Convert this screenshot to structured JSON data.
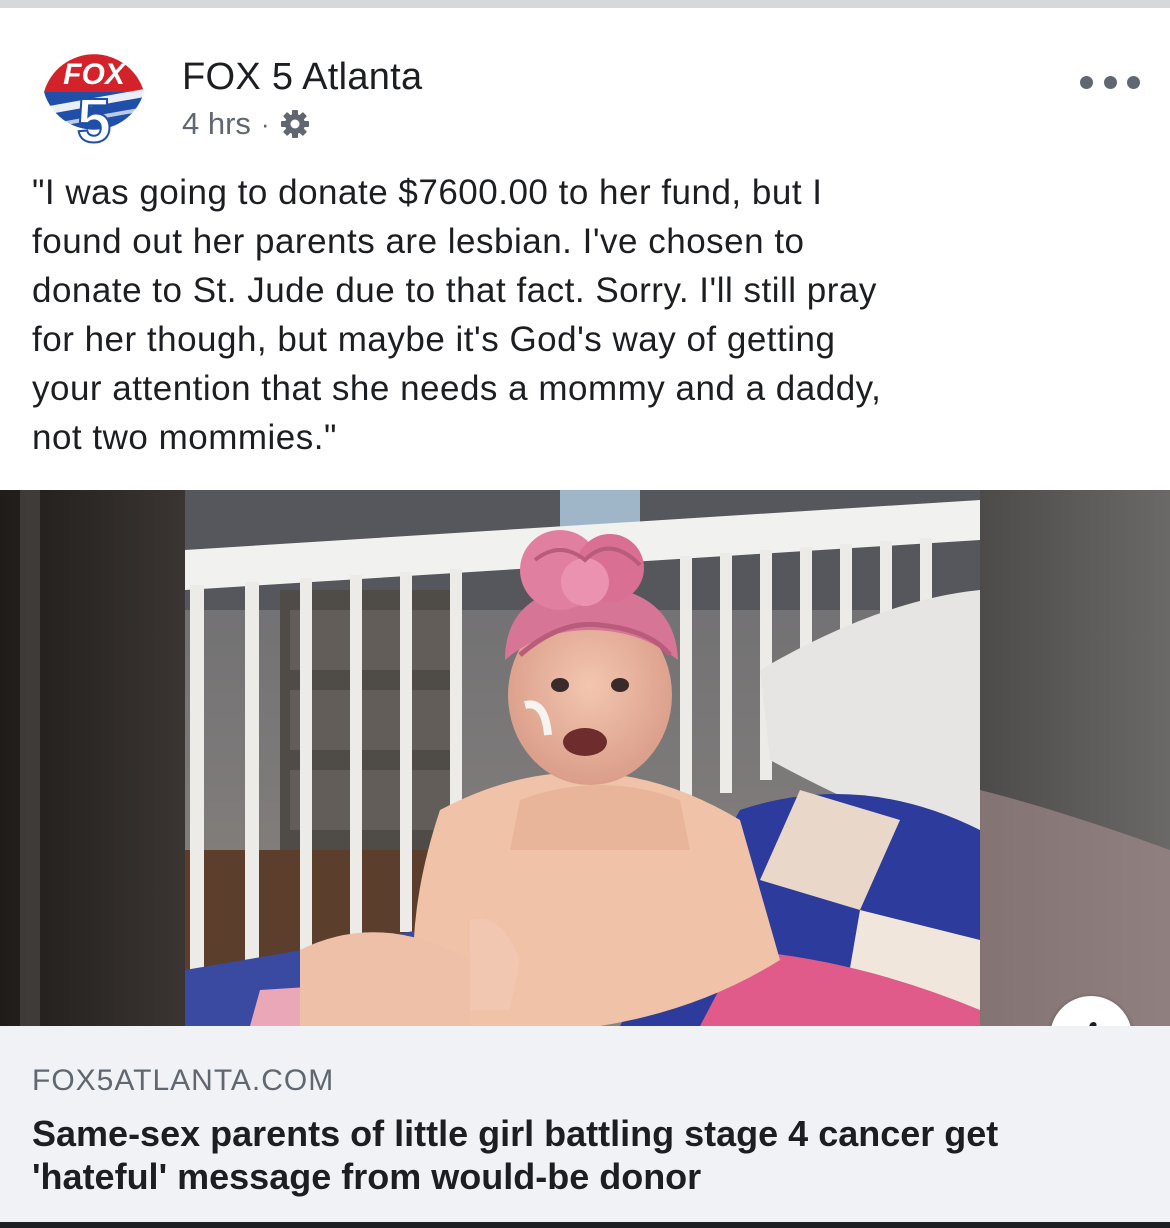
{
  "post": {
    "page_name": "FOX 5 Atlanta",
    "timestamp": "4 hrs",
    "separator": "·",
    "audience_icon": "gear-icon",
    "more_icon": "more-options-icon",
    "logo": {
      "top_text": "FOX",
      "number": "5",
      "colors": {
        "red": "#d3222a",
        "blue": "#1f4fa8",
        "white": "#ffffff"
      }
    },
    "text": "\"I was going to donate $7600.00 to her fund, but I\nfound out her parents are lesbian. I've chosen to\ndonate to St. Jude due to that fact. Sorry. I'll still pray\nfor her though, but maybe it's God's way of getting\nyour attention that she needs a mommy and a daddy,\nnot two mommies.\""
  },
  "photo": {
    "subject": "toddler in pink turban sitting in hospital crib"
  },
  "info_button": {
    "label": "i"
  },
  "link_preview": {
    "domain": "FOX5ATLANTA.COM",
    "title": "Same-sex parents of little girl battling stage 4 cancer get 'hateful' message from would-be donor"
  }
}
